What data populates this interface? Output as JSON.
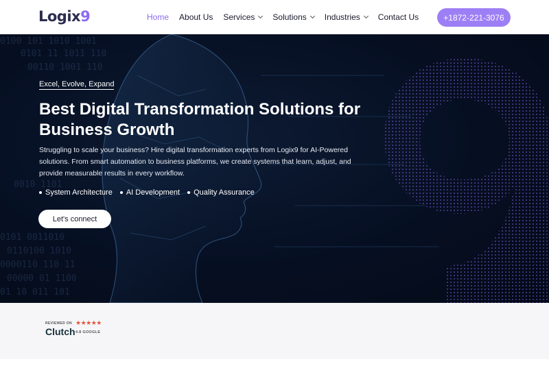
{
  "header": {
    "logo_text": "Logix",
    "logo_accent": "9",
    "nav": [
      {
        "label": "Home",
        "active": true,
        "dropdown": false
      },
      {
        "label": "About Us",
        "active": false,
        "dropdown": false
      },
      {
        "label": "Services",
        "active": false,
        "dropdown": true
      },
      {
        "label": "Solutions",
        "active": false,
        "dropdown": true
      },
      {
        "label": "Industries",
        "active": false,
        "dropdown": true
      },
      {
        "label": "Contact Us",
        "active": false,
        "dropdown": false
      }
    ],
    "phone": "+1872-221-3076"
  },
  "hero": {
    "tagline": "Excel, Evolve, Expand",
    "title": "Best Digital Transformation Solutions for Business Growth",
    "description": "Struggling to scale your business? Hire digital transformation experts from Logix9 for AI-Powered solutions. From smart automation to business platforms, we create systems that learn, adjust, and provide measurable results in every workflow.",
    "bullets": [
      "System Architecture",
      "AI Development",
      "Quality Assurance"
    ],
    "cta": "Let's connect"
  },
  "reviews": {
    "reviewed_on": "REVIEWED ON",
    "stars": "★★★★★",
    "platform": "Clutch",
    "rating": "4.8 GOOGLE"
  },
  "colors": {
    "accent": "#9d7ff5",
    "active_nav": "#8b6cf0",
    "hero_bg": "#060f22",
    "star": "#e4533a"
  }
}
